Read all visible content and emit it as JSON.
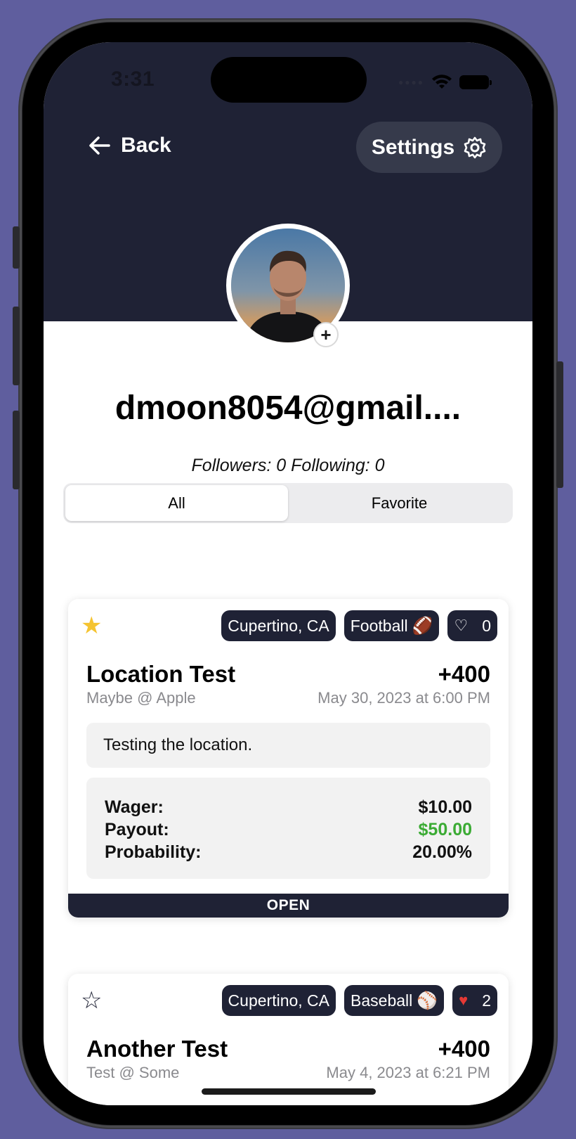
{
  "status_bar": {
    "time": "3:31"
  },
  "nav": {
    "back_label": "Back",
    "settings_label": "Settings"
  },
  "profile": {
    "username": "dmoon8054@gmail....",
    "followers_text": "Followers: 0  Following: 0"
  },
  "segment": {
    "options": [
      "All",
      "Favorite"
    ],
    "selected": "All"
  },
  "bets": [
    {
      "favorited": true,
      "location": "Cupertino, CA",
      "sport": "Football",
      "sport_emoji": "🏈",
      "likes": "0",
      "liked": false,
      "title": "Location Test",
      "odds": "+400",
      "subtitle": "Maybe @ Apple",
      "date": "May 30, 2023 at 6:00 PM",
      "description": "Testing the location.",
      "wager_label": "Wager:",
      "wager": "$10.00",
      "payout_label": "Payout:",
      "payout": "$50.00",
      "probability_label": "Probability:",
      "probability": "20.00%",
      "status": "OPEN"
    },
    {
      "favorited": false,
      "location": "Cupertino, CA",
      "sport": "Baseball",
      "sport_emoji": "⚾",
      "likes": "2",
      "liked": true,
      "title": "Another Test",
      "odds": "+400",
      "subtitle": "Test @ Some",
      "date": "May 4, 2023 at 6:21 PM"
    }
  ],
  "colors": {
    "header_bg": "#1f2235",
    "background": "#5f5e9e",
    "favorite_star": "#f5c431",
    "payout_green": "#3bab34",
    "like_red": "#e53935"
  }
}
